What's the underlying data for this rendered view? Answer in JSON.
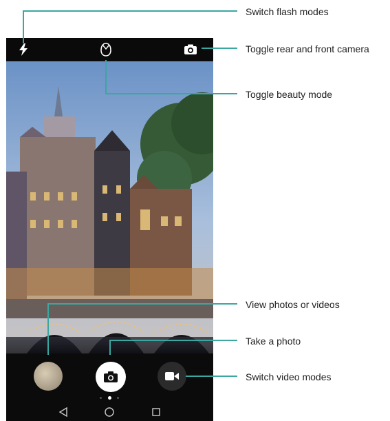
{
  "callouts": {
    "flash": "Switch flash modes",
    "switch_camera": "Toggle rear and front camera",
    "beauty": "Toggle beauty mode",
    "gallery": "View photos or videos",
    "shutter": "Take a photo",
    "video": "Switch video modes"
  },
  "colors": {
    "callout_line": "#3aa7a0",
    "controls_bg": "#0b0b0b"
  },
  "icons": {
    "flash": "lightning-bolt-icon",
    "beauty": "beauty-face-icon",
    "switch_camera": "camera-switch-icon",
    "gallery": "gallery-thumbnail",
    "shutter": "camera-icon",
    "video": "video-camera-icon",
    "nav_back": "triangle-back-icon",
    "nav_home": "circle-home-icon",
    "nav_recent": "square-recent-icon"
  }
}
